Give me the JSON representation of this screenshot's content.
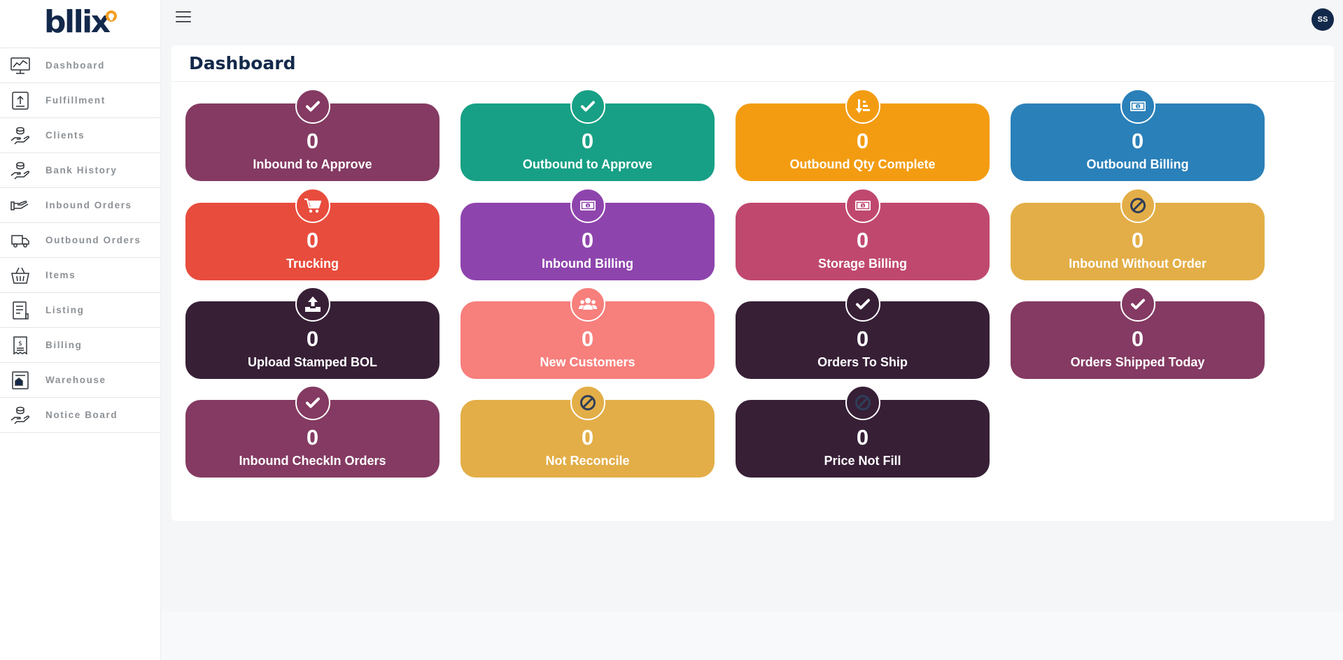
{
  "app": {
    "logo_text": "bllix",
    "avatar_initials": "SS",
    "page_title": "Dashboard"
  },
  "sidebar": {
    "items": [
      {
        "label": "Dashboard",
        "icon": "monitor-chart-icon"
      },
      {
        "label": "Fulfillment",
        "icon": "upload-box-icon"
      },
      {
        "label": "Clients",
        "icon": "hand-coins-icon"
      },
      {
        "label": "Bank History",
        "icon": "hand-coins-icon"
      },
      {
        "label": "Inbound Orders",
        "icon": "hand-receive-icon"
      },
      {
        "label": "Outbound Orders",
        "icon": "truck-icon"
      },
      {
        "label": "Items",
        "icon": "basket-icon"
      },
      {
        "label": "Listing",
        "icon": "list-document-icon"
      },
      {
        "label": "Billing",
        "icon": "invoice-icon"
      },
      {
        "label": "Warehouse",
        "icon": "warehouse-icon"
      },
      {
        "label": "Notice Board",
        "icon": "hand-coins-icon"
      }
    ]
  },
  "tiles": [
    {
      "label": "Inbound to Approve",
      "count": "0",
      "icon": "check",
      "color": "#843a62"
    },
    {
      "label": "Outbound to Approve",
      "count": "0",
      "icon": "check",
      "color": "#17a085"
    },
    {
      "label": "Outbound Qty Complete",
      "count": "0",
      "icon": "sort-down",
      "color": "#f39c12"
    },
    {
      "label": "Outbound Billing",
      "count": "0",
      "icon": "money",
      "color": "#2a80b9"
    },
    {
      "label": "Trucking",
      "count": "0",
      "icon": "cart",
      "color": "#e84c3d"
    },
    {
      "label": "Inbound Billing",
      "count": "0",
      "icon": "money",
      "color": "#8e44ad"
    },
    {
      "label": "Storage Billing",
      "count": "0",
      "icon": "money",
      "color": "#c0486f"
    },
    {
      "label": "Inbound Without Order",
      "count": "0",
      "icon": "ban",
      "color": "#e3ae47"
    },
    {
      "label": "Upload Stamped BOL",
      "count": "0",
      "icon": "upload",
      "color": "#371f36"
    },
    {
      "label": "New Customers",
      "count": "0",
      "icon": "users",
      "color": "#f77f7c"
    },
    {
      "label": "Orders To Ship",
      "count": "0",
      "icon": "check",
      "color": "#371f36"
    },
    {
      "label": "Orders Shipped Today",
      "count": "0",
      "icon": "check",
      "color": "#843a62"
    },
    {
      "label": "Inbound CheckIn Orders",
      "count": "0",
      "icon": "check",
      "color": "#843a62"
    },
    {
      "label": "Not Reconcile",
      "count": "0",
      "icon": "ban",
      "color": "#e3ae47"
    },
    {
      "label": "Price Not Fill",
      "count": "0",
      "icon": "ban",
      "color": "#371f36"
    }
  ]
}
